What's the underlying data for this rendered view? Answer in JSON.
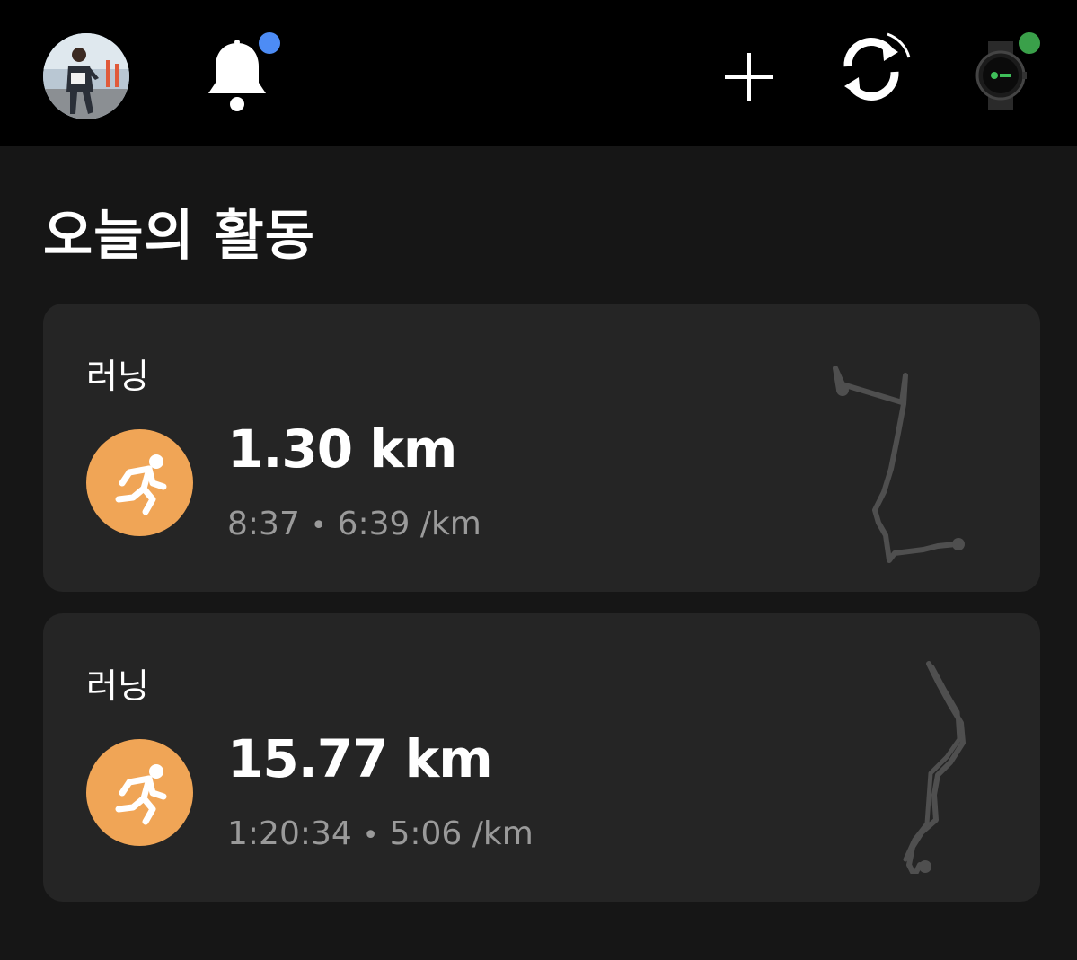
{
  "header": {
    "avatar_icon": "profile-photo",
    "notifications_icon": "bell-icon",
    "notification_dot_color": "#4d8cf5",
    "add_icon": "plus-icon",
    "sync_icon": "sync-icon",
    "device_icon": "smartwatch-icon",
    "device_dot_color": "#3aa04a"
  },
  "section": {
    "title": "오늘의 활동"
  },
  "activities": [
    {
      "type": "러닝",
      "icon": "running-icon",
      "distance": "1.30 km",
      "duration": "8:37",
      "separator": "•",
      "pace": "6:39 /km",
      "route_icon": "route-map"
    },
    {
      "type": "러닝",
      "icon": "running-icon",
      "distance": "15.77 km",
      "duration": "1:20:34",
      "separator": "•",
      "pace": "5:06 /km",
      "route_icon": "route-map"
    }
  ],
  "colors": {
    "accent_orange": "#f0a556",
    "card_bg": "#252525",
    "page_bg": "#161616",
    "header_bg": "#000000",
    "secondary_text": "#9a9a9a"
  }
}
